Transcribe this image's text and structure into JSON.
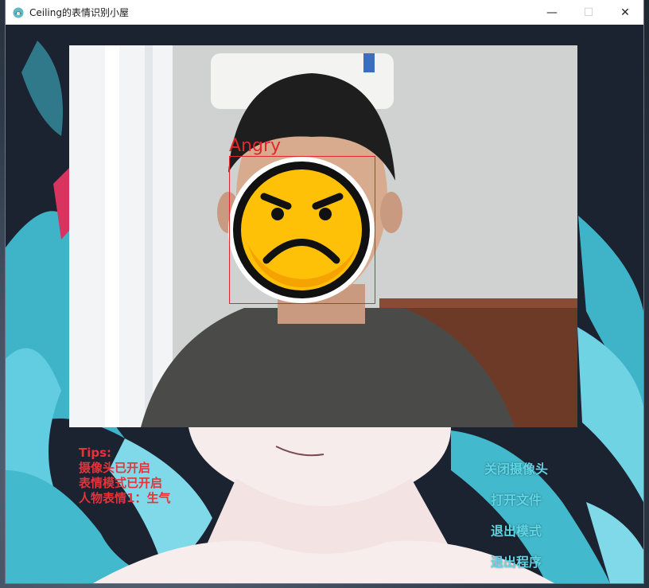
{
  "window": {
    "title": "Ceiling的表情识别小屋",
    "minimize": "—",
    "maximize": "☐",
    "close": "✕"
  },
  "camera": {
    "detection_label": "Angry"
  },
  "tips": {
    "heading": "Tips:",
    "lines": [
      "摄像头已开启",
      "表情模式已开启",
      "人物表情1：生气"
    ]
  },
  "actions": {
    "close_camera": "关闭摄像头",
    "open_file": "打开文件",
    "exit_mode": "退出模式",
    "exit_program": "退出程序"
  },
  "colors": {
    "tips": "#e8323a",
    "actions": "#5fd6e4",
    "face_box": "#e0282c",
    "background": "#1b2230"
  }
}
